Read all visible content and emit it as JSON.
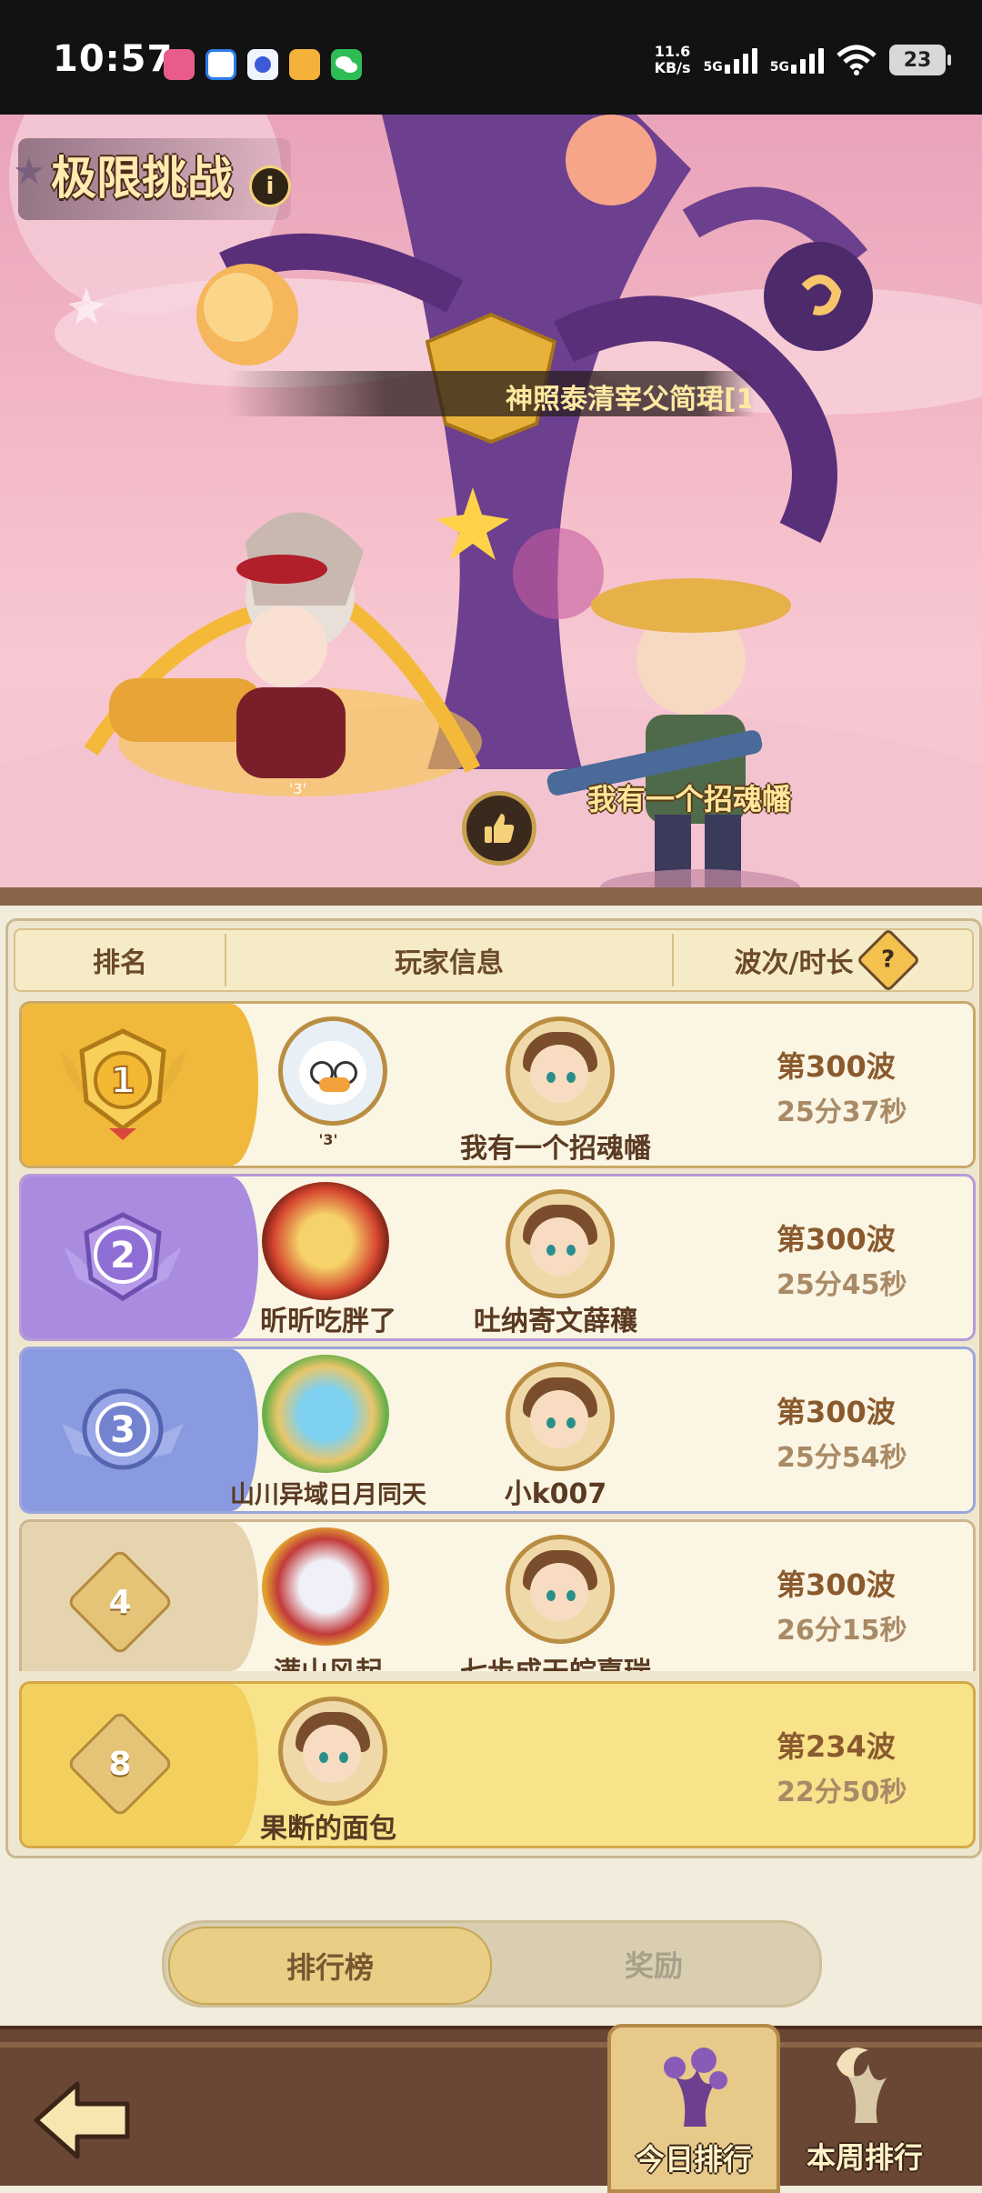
{
  "status_bar": {
    "time": "10:57",
    "net_speed_value": "11.6",
    "net_speed_unit": "KB/s",
    "signal_1": "5G",
    "signal_2": "5G",
    "battery": "23",
    "app_icons": [
      "lofter-icon",
      "qq-browser-icon",
      "lens-icon",
      "mall-icon",
      "wechat-icon"
    ]
  },
  "banner": {
    "title": "极限挑战",
    "info_icon": "i",
    "top_player_name": "神照泰清宰父简珺[1",
    "featured_char_name": "我有一个招魂幡",
    "featured_tag": "'3'"
  },
  "table_header": {
    "rank": "排名",
    "player_info": "玩家信息",
    "wave_time": "波次/时长",
    "help": "?"
  },
  "rows": [
    {
      "rank": "1",
      "player1": "'3'",
      "player2": "我有一个招魂幡",
      "wave": "第300波",
      "time": "25分37秒"
    },
    {
      "rank": "2",
      "player1": "昕昕吃胖了",
      "player2": "吐纳寄文薛穰",
      "wave": "第300波",
      "time": "25分45秒"
    },
    {
      "rank": "3",
      "player1": "山川异域日月同天",
      "player2": "小k007",
      "wave": "第300波",
      "time": "25分54秒"
    },
    {
      "rank": "4",
      "player1": "满山风起",
      "player2": "七步成天皖嘉瑞",
      "wave": "第300波",
      "time": "26分15秒"
    }
  ],
  "my_row": {
    "rank": "8",
    "player1": "果断的面包",
    "wave": "第234波",
    "time": "22分50秒"
  },
  "tabs": {
    "leaderboard": "排行榜",
    "reward": "奖励"
  },
  "bottom_nav": {
    "today": "今日排行",
    "week": "本周排行"
  },
  "colors": {
    "gold": "#f2c14e",
    "silver_purple": "#a98be0",
    "bronze_blue": "#8a9ae0",
    "my_row_bg": "#f8e38a",
    "brown_text": "#5a3a22"
  }
}
